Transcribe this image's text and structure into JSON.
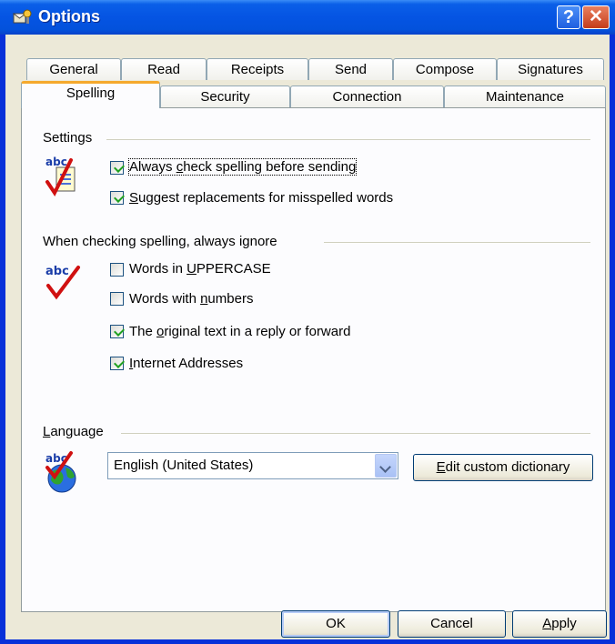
{
  "window": {
    "title": "Options"
  },
  "tabs_row1": [
    "General",
    "Read",
    "Receipts",
    "Send",
    "Compose",
    "Signatures"
  ],
  "tabs_row2": [
    "Spelling",
    "Security",
    "Connection",
    "Maintenance"
  ],
  "settings": {
    "title": "Settings",
    "options": [
      {
        "pre": "Always ",
        "key": "c",
        "post": "heck spelling before sending",
        "checked": true
      },
      {
        "pre": "",
        "key": "S",
        "post": "uggest replacements for misspelled words",
        "checked": true
      }
    ]
  },
  "ignore": {
    "title": "When checking spelling, always ignore",
    "options": [
      {
        "pre": "Words in ",
        "key": "U",
        "post": "PPERCASE",
        "checked": false
      },
      {
        "pre": "Words with ",
        "key": "n",
        "post": "umbers",
        "checked": false
      },
      {
        "pre": "The ",
        "key": "o",
        "post": "riginal text in a reply or forward",
        "checked": true
      },
      {
        "pre": "",
        "key": "I",
        "post": "nternet Addresses",
        "checked": true
      }
    ]
  },
  "language": {
    "title_key": "L",
    "title_rest": "anguage",
    "selected": "English (United States)",
    "edit_key": "E",
    "edit_rest": "dit custom dictionary"
  },
  "buttons": {
    "ok": "OK",
    "cancel": "Cancel",
    "apply_key": "A",
    "apply_rest": "pply"
  },
  "icons": {
    "title": "options-window-icon",
    "spelling": "abc-spellcheck-icon",
    "language": "abc-globe-icon"
  },
  "colors": {
    "titlebar": "#0554e3",
    "frame": "#0831d9",
    "tab_accent": "#f5a92d",
    "check": "#21a121"
  }
}
